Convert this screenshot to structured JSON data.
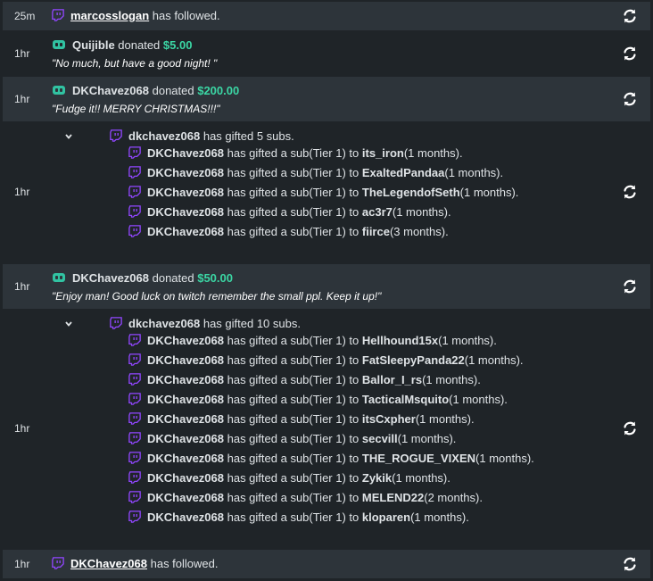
{
  "colors": {
    "accent_green": "#3bd6a4",
    "twitch_purple": "#9146ff",
    "row_alt": "#2d343a",
    "row_dark": "#1f2428"
  },
  "events": {
    "e0": {
      "time": "25m",
      "user": "marcosslogan",
      "text": " has followed."
    },
    "e1": {
      "time": "1hr",
      "user": "Quijible",
      "donated": " donated ",
      "amount": "$5.00",
      "message": "\"No much, but have a good night! \""
    },
    "e2": {
      "time": "1hr",
      "user": "DKChavez068",
      "donated": " donated ",
      "amount": "$200.00",
      "message": "\"Fudge it!! MERRY CHRISTMAS!!!\""
    },
    "e3": {
      "time": "1hr",
      "header_user": "dkchavez068",
      "header_text": " has gifted 5 subs.",
      "gifts": [
        {
          "gifter": "DKChavez068",
          "mid": " has gifted a sub(Tier 1) to ",
          "recipient": "its_iron",
          "months": "(1 months)."
        },
        {
          "gifter": "DKChavez068",
          "mid": " has gifted a sub(Tier 1) to ",
          "recipient": "ExaltedPandaa",
          "months": "(1 months)."
        },
        {
          "gifter": "DKChavez068",
          "mid": " has gifted a sub(Tier 1) to ",
          "recipient": "TheLegendofSeth",
          "months": "(1 months)."
        },
        {
          "gifter": "DKChavez068",
          "mid": " has gifted a sub(Tier 1) to ",
          "recipient": "ac3r7",
          "months": "(1 months)."
        },
        {
          "gifter": "DKChavez068",
          "mid": " has gifted a sub(Tier 1) to ",
          "recipient": "fiirce",
          "months": "(3 months)."
        }
      ]
    },
    "e4": {
      "time": "1hr",
      "user": "DKChavez068",
      "donated": " donated ",
      "amount": "$50.00",
      "message": "\"Enjoy man! Good luck on twitch remember the small ppl. Keep it up!\""
    },
    "e5": {
      "time": "1hr",
      "header_user": "dkchavez068",
      "header_text": " has gifted 10 subs.",
      "gifts": [
        {
          "gifter": "DKChavez068",
          "mid": " has gifted a sub(Tier 1) to ",
          "recipient": "Hellhound15x",
          "months": "(1 months)."
        },
        {
          "gifter": "DKChavez068",
          "mid": " has gifted a sub(Tier 1) to ",
          "recipient": "FatSleepyPanda22",
          "months": "(1 months)."
        },
        {
          "gifter": "DKChavez068",
          "mid": " has gifted a sub(Tier 1) to ",
          "recipient": "Ballor_I_rs",
          "months": "(1 months)."
        },
        {
          "gifter": "DKChavez068",
          "mid": " has gifted a sub(Tier 1) to ",
          "recipient": "TacticalMsquito",
          "months": "(1 months)."
        },
        {
          "gifter": "DKChavez068",
          "mid": " has gifted a sub(Tier 1) to ",
          "recipient": "itsCxpher",
          "months": "(1 months)."
        },
        {
          "gifter": "DKChavez068",
          "mid": " has gifted a sub(Tier 1) to ",
          "recipient": "secvill",
          "months": "(1 months)."
        },
        {
          "gifter": "DKChavez068",
          "mid": " has gifted a sub(Tier 1) to ",
          "recipient": "THE_ROGUE_VIXEN",
          "months": "(1 months)."
        },
        {
          "gifter": "DKChavez068",
          "mid": " has gifted a sub(Tier 1) to ",
          "recipient": "Zykik",
          "months": "(1 months)."
        },
        {
          "gifter": "DKChavez068",
          "mid": " has gifted a sub(Tier 1) to ",
          "recipient": "MELEND22",
          "months": "(2 months)."
        },
        {
          "gifter": "DKChavez068",
          "mid": " has gifted a sub(Tier 1) to ",
          "recipient": "kloparen",
          "months": "(1 months)."
        }
      ]
    },
    "e6": {
      "time": "1hr",
      "user": "DKChavez068",
      "text": " has followed."
    }
  },
  "icons": {
    "platform": "twitch-icon",
    "donation": "streamlabs-icon",
    "refresh": "refresh-icon",
    "expand": "chevron-down-icon"
  }
}
